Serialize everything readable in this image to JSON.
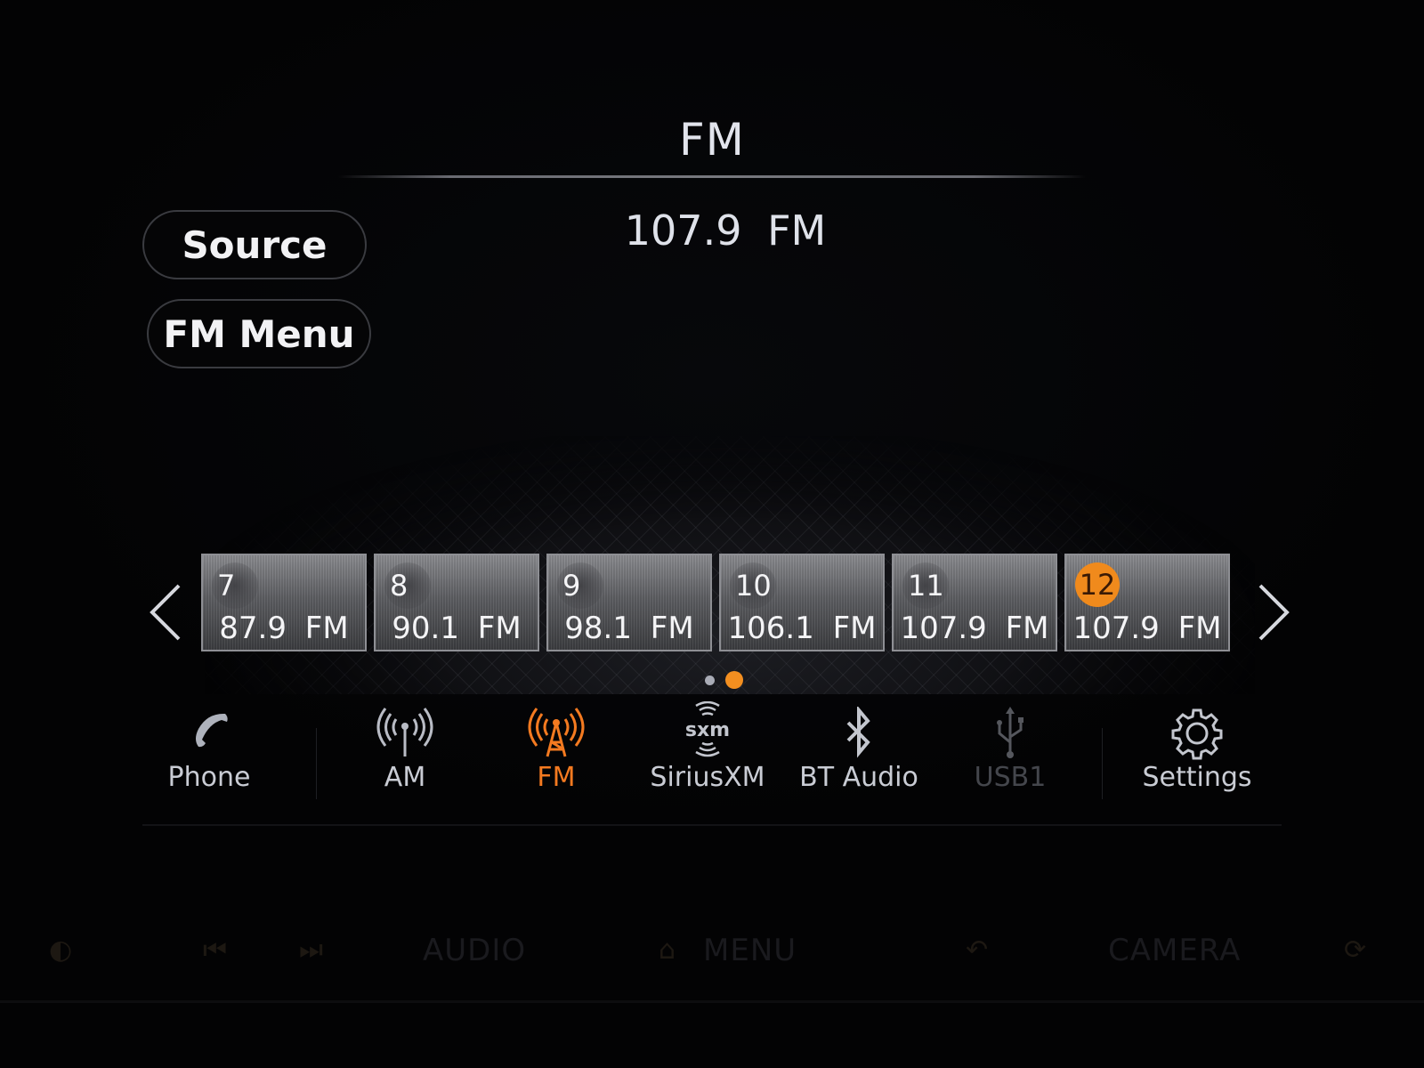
{
  "header": {
    "title": "FM",
    "current_station": "107.9  FM"
  },
  "buttons": {
    "source": "Source",
    "fm_menu": "FM Menu"
  },
  "presets": {
    "page": 2,
    "page_count": 2,
    "active_preset": 12,
    "items": [
      {
        "number": "7",
        "station": "87.9  FM"
      },
      {
        "number": "8",
        "station": "90.1  FM"
      },
      {
        "number": "9",
        "station": "98.1  FM"
      },
      {
        "number": "10",
        "station": "106.1  FM"
      },
      {
        "number": "11",
        "station": "107.9  FM"
      },
      {
        "number": "12",
        "station": "107.9  FM"
      }
    ]
  },
  "nav": {
    "items": [
      {
        "label": "Phone",
        "icon": "phone-icon",
        "state": "normal"
      },
      {
        "label": "AM",
        "icon": "antenna-icon",
        "state": "normal"
      },
      {
        "label": "FM",
        "icon": "radio-tower-icon",
        "state": "active"
      },
      {
        "label": "SiriusXM",
        "icon": "sxm-icon",
        "state": "normal"
      },
      {
        "label": "BT Audio",
        "icon": "bluetooth-icon",
        "state": "normal"
      },
      {
        "label": "USB1",
        "icon": "usb-icon",
        "state": "disabled"
      },
      {
        "label": "Settings",
        "icon": "gear-icon",
        "state": "normal"
      }
    ],
    "sxm_logo_text": "sxm"
  },
  "bezel": {
    "audio": "AUDIO",
    "menu": "MENU",
    "camera": "CAMERA"
  },
  "colors": {
    "accent": "#f47a20",
    "text": "#e2e4ec",
    "background": "#030304",
    "disabled": "#44464c"
  }
}
